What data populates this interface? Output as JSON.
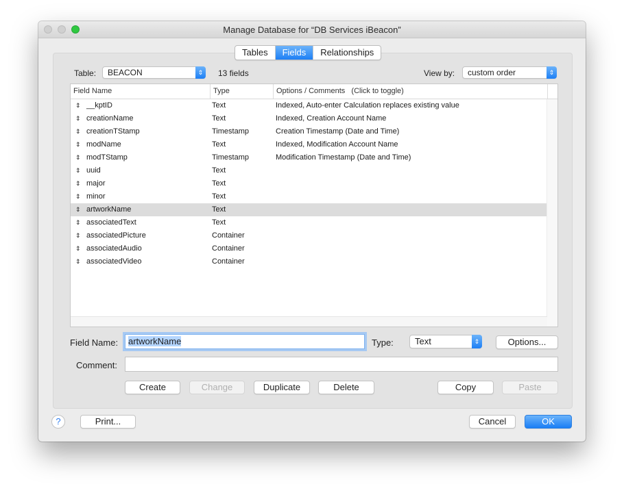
{
  "window": {
    "title": "Manage Database for “DB Services iBeacon”",
    "traffic_lights": [
      "close",
      "minimize",
      "zoom"
    ]
  },
  "tabs": [
    {
      "label": "Tables",
      "active": false
    },
    {
      "label": "Fields",
      "active": true
    },
    {
      "label": "Relationships",
      "active": false
    }
  ],
  "toolbar": {
    "table_label": "Table:",
    "table_value": "BEACON",
    "field_count": "13 fields",
    "view_by_label": "View by:",
    "view_by_value": "custom order"
  },
  "field_table": {
    "columns": [
      "Field Name",
      "Type",
      "Options / Comments   (Click to toggle)"
    ],
    "rows": [
      {
        "name": "__kptID",
        "type": "Text",
        "options": "Indexed, Auto-enter Calculation replaces existing value"
      },
      {
        "name": "creationName",
        "type": "Text",
        "options": "Indexed, Creation Account Name"
      },
      {
        "name": "creationTStamp",
        "type": "Timestamp",
        "options": "Creation Timestamp (Date and Time)"
      },
      {
        "name": "modName",
        "type": "Text",
        "options": "Indexed, Modification Account Name"
      },
      {
        "name": "modTStamp",
        "type": "Timestamp",
        "options": "Modification Timestamp (Date and Time)"
      },
      {
        "name": "uuid",
        "type": "Text",
        "options": ""
      },
      {
        "name": "major",
        "type": "Text",
        "options": ""
      },
      {
        "name": "minor",
        "type": "Text",
        "options": ""
      },
      {
        "name": "artworkName",
        "type": "Text",
        "options": "",
        "selected": true
      },
      {
        "name": "associatedText",
        "type": "Text",
        "options": ""
      },
      {
        "name": "associatedPicture",
        "type": "Container",
        "options": ""
      },
      {
        "name": "associatedAudio",
        "type": "Container",
        "options": ""
      },
      {
        "name": "associatedVideo",
        "type": "Container",
        "options": ""
      }
    ]
  },
  "editor": {
    "field_name_label": "Field Name:",
    "field_name_value": "artworkName",
    "type_label": "Type:",
    "type_value": "Text",
    "options_button": "Options...",
    "comment_label": "Comment:",
    "comment_value": ""
  },
  "actions": {
    "create": "Create",
    "change": "Change",
    "duplicate": "Duplicate",
    "delete": "Delete",
    "copy": "Copy",
    "paste": "Paste"
  },
  "footer": {
    "help": "?",
    "print": "Print...",
    "cancel": "Cancel",
    "ok": "OK"
  },
  "colors": {
    "accent": "#1d7ff5",
    "selected_row": "#dcdcdc",
    "text_selection": "#b4d5fe"
  }
}
